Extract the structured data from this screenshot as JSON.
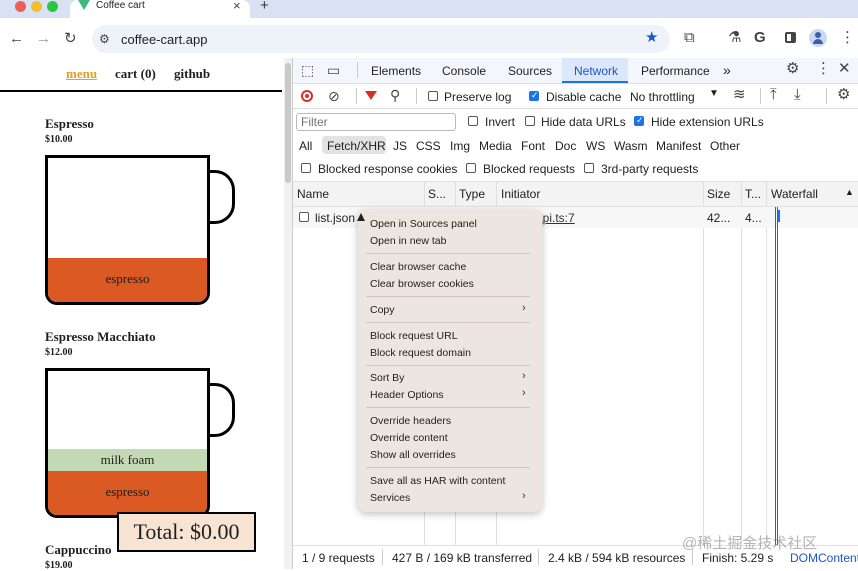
{
  "browser": {
    "tab_title": "Coffee cart",
    "tab_close": "×",
    "new_tab": "+",
    "url": "coffee-cart.app",
    "colors": {
      "traffic_red": "#ee5f57",
      "traffic_yellow": "#f5bd2e",
      "traffic_green": "#28c840",
      "titlebar": "#d9e2f2",
      "star": "#1a57c9"
    },
    "icons": [
      "back-icon",
      "forward-icon",
      "reload-icon",
      "site-info-icon",
      "bookmark-star-icon",
      "extensions-icon",
      "labs-icon",
      "google-icon",
      "sidebar-icon",
      "profile-icon",
      "menu-dots-icon"
    ]
  },
  "site": {
    "nav": {
      "menu": "menu",
      "cart": "cart (0)",
      "github": "github"
    },
    "products": [
      {
        "name": "Espresso",
        "price": "$10.00",
        "layers": [
          "espresso"
        ]
      },
      {
        "name": "Espresso Macchiato",
        "price": "$12.00",
        "layers": [
          "milk foam",
          "espresso"
        ]
      },
      {
        "name": "Cappuccino",
        "price": "$19.00"
      }
    ],
    "total": "Total: $0.00",
    "colors": {
      "espresso": "#db5a24",
      "milk_foam": "#c2d9b3",
      "menu_link": "#e6a11e",
      "total_bg": "#f8e4d3"
    }
  },
  "devtools": {
    "tabs": [
      "Elements",
      "Console",
      "Sources",
      "Network",
      "Performance"
    ],
    "active_tab": "Network",
    "more_tabs": "»",
    "toolbar": {
      "preserve_log": "Preserve log",
      "disable_cache": "Disable cache",
      "throttling": "No throttling"
    },
    "filter": {
      "placeholder": "Filter",
      "invert": "Invert",
      "hide_data_urls": "Hide data URLs",
      "hide_extension_urls": "Hide extension URLs"
    },
    "types": [
      "All",
      "Fetch/XHR",
      "JS",
      "CSS",
      "Img",
      "Media",
      "Font",
      "Doc",
      "WS",
      "Wasm",
      "Manifest",
      "Other"
    ],
    "active_type": "Fetch/XHR",
    "options": {
      "blocked_cookies": "Blocked response cookies",
      "blocked_requests": "Blocked requests",
      "third_party": "3rd-party requests"
    },
    "columns": [
      "Name",
      "S...",
      "Type",
      "Initiator",
      "Size",
      "T...",
      "Waterfall"
    ],
    "rows": [
      {
        "name": "list.json",
        "initiator": "api.ts:7",
        "size": "42...",
        "time": "4..."
      }
    ],
    "status": {
      "requests": "1 / 9 requests",
      "transferred": "427 B / 169 kB transferred",
      "resources": "2.4 kB / 594 kB resources",
      "finish": "Finish: 5.29 s",
      "domcontent": "DOMContent"
    },
    "context_menu": {
      "groups": [
        [
          "Open in Sources panel",
          "Open in new tab"
        ],
        [
          "Clear browser cache",
          "Clear browser cookies"
        ],
        [
          "Copy"
        ],
        [
          "Block request URL",
          "Block request domain"
        ],
        [
          "Sort By",
          "Header Options"
        ],
        [
          "Override headers",
          "Override content",
          "Show all overrides"
        ],
        [
          "Save all as HAR with content",
          "Services"
        ]
      ],
      "submenu_items": [
        "Copy",
        "Sort By",
        "Header Options",
        "Services"
      ]
    },
    "colors": {
      "accent": "#1a73e8",
      "record": "#d93025",
      "filter_icon": "#d93025"
    }
  },
  "watermark": "@稀土掘金技术社区"
}
